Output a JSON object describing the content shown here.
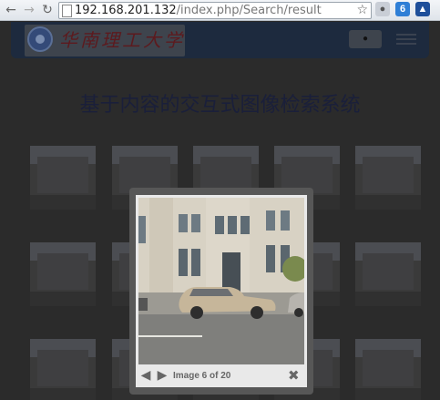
{
  "browser": {
    "back_icon": "arrow-left-icon",
    "forward_icon": "arrow-right-icon",
    "reload_icon": "reload-icon",
    "url_host": "192.168.201.132",
    "url_path": "/index.php/Search/result",
    "bookmark_icon": "star-icon"
  },
  "navbar": {
    "logo_text": "华南理工大学",
    "toggle_icon": "menu-icon"
  },
  "page": {
    "title": "基于内容的交互式图像检索系统"
  },
  "lightbox": {
    "counter": "Image 6 of 20",
    "prev_icon": "arrow-left-icon",
    "next_icon": "arrow-right-icon",
    "close_icon": "close-icon"
  },
  "colors": {
    "overlay": "#2b2b2b",
    "navbar": "#1d2a3e",
    "lightbox_frame": "#575757",
    "lightbox_panel": "#e9e9e9"
  }
}
